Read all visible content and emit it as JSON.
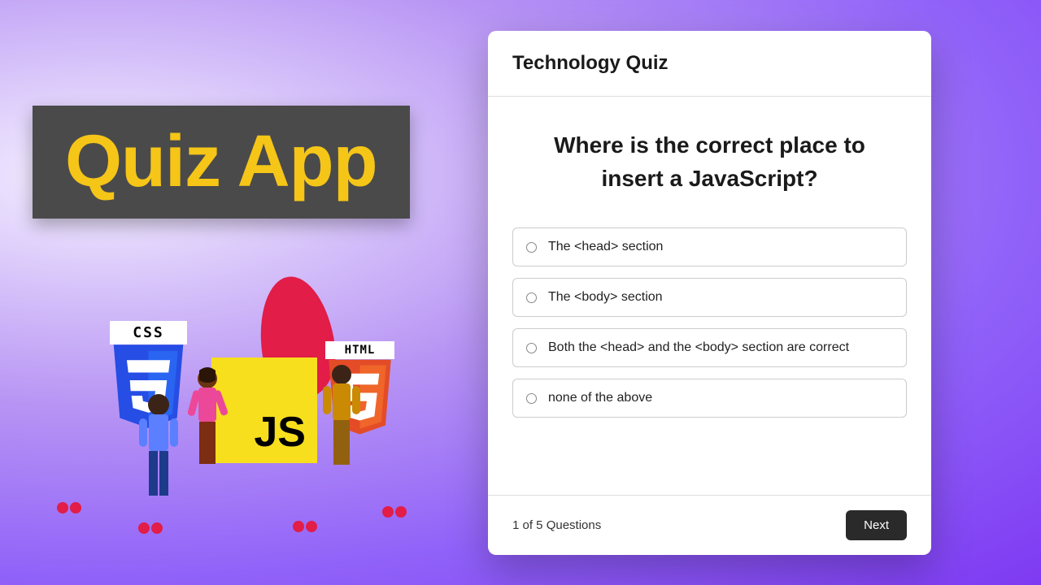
{
  "banner": {
    "title": "Quiz App"
  },
  "logos": {
    "css_label": "CSS",
    "js_label": "JS",
    "html_label": "HTML"
  },
  "quiz": {
    "header_title": "Technology Quiz",
    "question": "Where is the correct place to insert a JavaScript?",
    "options": [
      "The <head> section",
      "The <body> section",
      "Both the <head> and the <body> section are correct",
      "none of the above"
    ],
    "progress": "1 of 5 Questions",
    "next_label": "Next"
  }
}
